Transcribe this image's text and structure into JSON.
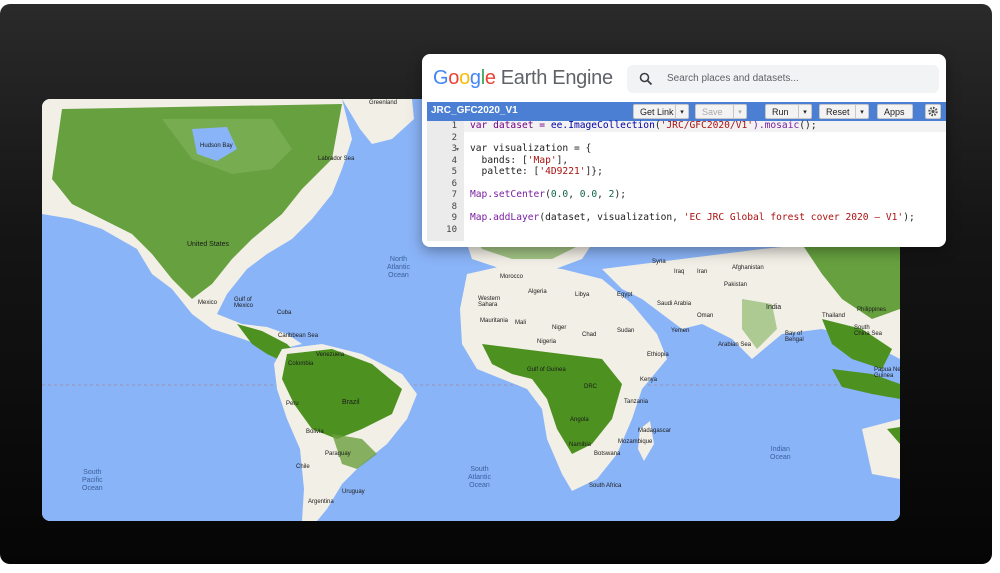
{
  "app": {
    "logo_letters": [
      "G",
      "o",
      "o",
      "g",
      "l",
      "e"
    ],
    "logo_suffix": "Earth Engine",
    "search_placeholder": "Search places and datasets..."
  },
  "toolbar": {
    "script_title": "JRC_GFC2020_V1",
    "get_link_label": "Get Link",
    "save_label": "Save",
    "run_label": "Run",
    "reset_label": "Reset",
    "apps_label": "Apps"
  },
  "code": {
    "line_numbers": [
      "1",
      "2",
      "3",
      "4",
      "5",
      "6",
      "7",
      "8",
      "9",
      "10"
    ],
    "line1": {
      "a": "var dataset = ",
      "b": "ee.ImageCollection",
      "c": "(",
      "d": "'JRC/GFC2020/V1'",
      "e": ").mosaic",
      "f": "();"
    },
    "line3": "var visualization = {",
    "line4": {
      "a": "  bands: [",
      "b": "'Map'",
      "c": "],"
    },
    "line5": {
      "a": "  palette: [",
      "b": "'4D9221'",
      "c": "]};"
    },
    "line7": {
      "a": "Map.setCenter",
      "b": "(",
      "c": "0.0",
      "d": ", ",
      "e": "0.0",
      "f": ", ",
      "g": "2",
      "h": ");"
    },
    "line9": {
      "a": "Map.addLayer",
      "b": "(dataset, visualization, ",
      "c": "'EC JRC Global forest cover 2020 – V1'",
      "d": ");"
    }
  },
  "map": {
    "labels": {
      "greenland": "Greenland",
      "hudson": "Hudson Bay",
      "labrador": "Labrador Sea",
      "us": "United States",
      "mexico": "Mexico",
      "gulf_mexico": "Gulf of\nMexico",
      "cuba": "Cuba",
      "caribbean": "Caribbean Sea",
      "venezuela": "Venezuela",
      "colombia": "Colombia",
      "peru": "Peru",
      "brazil": "Brazil",
      "bolivia": "Bolivia",
      "paraguay": "Paraguay",
      "chile": "Chile",
      "argentina": "Argentina",
      "uruguay": "Uruguay",
      "morocco": "Morocco",
      "algeria": "Algeria",
      "libya": "Libya",
      "egypt": "Egypt",
      "w_sahara": "Western\nSahara",
      "mauritania": "Mauritania",
      "mali": "Mali",
      "niger": "Niger",
      "chad": "Chad",
      "sudan": "Sudan",
      "nigeria": "Nigeria",
      "ethiopia": "Ethiopia",
      "kenya": "Kenya",
      "tanzania": "Tanzania",
      "drc": "DRC",
      "angola": "Angola",
      "namibia": "Namibia",
      "botswana": "Botswana",
      "south_africa": "South Africa",
      "mozambique": "Mozambique",
      "madagascar": "Madagascar",
      "gulf_guinea": "Gulf of Guinea",
      "saudi": "Saudi Arabia",
      "yemen": "Yemen",
      "oman": "Oman",
      "iraq": "Iraq",
      "iran": "Iran",
      "syria": "Syria",
      "afghanistan": "Afghanistan",
      "pakistan": "Pakistan",
      "india": "India",
      "arabian_sea": "Arabian Sea",
      "bay_bengal": "Bay of\nBengal",
      "thailand": "Thailand",
      "s_china_sea": "South\nChina Sea",
      "philippines": "Philippines",
      "papua": "Papua New\nGuinea"
    },
    "oceans": {
      "n_atlantic": "North\nAtlantic\nOcean",
      "s_atlantic": "South\nAtlantic\nOcean",
      "s_pacific": "South\nPacific\nOcean",
      "indian": "Indian\nOcean"
    },
    "colors": {
      "ocean": "#8ab4f8",
      "land": "#f2efe6",
      "forest": "#4d9221"
    }
  }
}
